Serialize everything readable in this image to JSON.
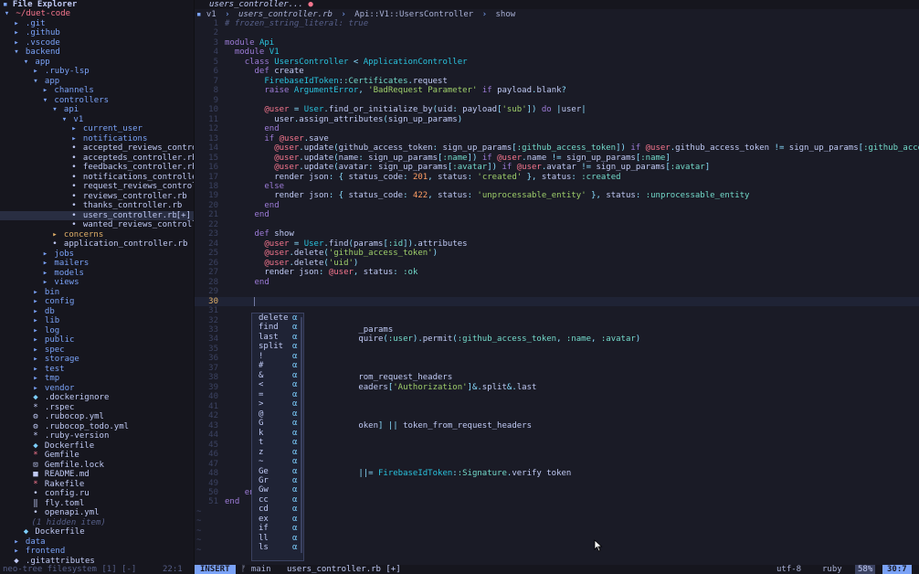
{
  "sidebar": {
    "title": "File Explorer",
    "hidden_note": "(1 hidden item)",
    "rows": [
      {
        "indent": 0,
        "icon": "▾",
        "label": "~/duet-code",
        "kind": "root"
      },
      {
        "indent": 1,
        "icon": "▸",
        "label": ".git",
        "kind": "dir"
      },
      {
        "indent": 1,
        "icon": "▸",
        "label": ".github",
        "kind": "dir"
      },
      {
        "indent": 1,
        "icon": "▸",
        "label": ".vscode",
        "kind": "dir"
      },
      {
        "indent": 1,
        "icon": "▾",
        "label": "backend",
        "kind": "dir"
      },
      {
        "indent": 2,
        "icon": "▾",
        "label": "app",
        "kind": "dir"
      },
      {
        "indent": 3,
        "icon": "▸",
        "label": ".ruby-lsp",
        "kind": "dir"
      },
      {
        "indent": 3,
        "icon": "▾",
        "label": "app",
        "kind": "dir"
      },
      {
        "indent": 4,
        "icon": "▸",
        "label": "channels",
        "kind": "dir"
      },
      {
        "indent": 4,
        "icon": "▾",
        "label": "controllers",
        "kind": "dir"
      },
      {
        "indent": 5,
        "icon": "▾",
        "label": "api",
        "kind": "dir"
      },
      {
        "indent": 6,
        "icon": "▾",
        "label": "v1",
        "kind": "dir"
      },
      {
        "indent": 7,
        "icon": "▸",
        "label": "current_user",
        "kind": "dir"
      },
      {
        "indent": 7,
        "icon": "▸",
        "label": "notifications",
        "kind": "dir"
      },
      {
        "indent": 7,
        "icon": "•",
        "label": "accepted_reviews_contro",
        "kind": "file"
      },
      {
        "indent": 7,
        "icon": "•",
        "label": "accepteds_controller.rb",
        "kind": "file"
      },
      {
        "indent": 7,
        "icon": "•",
        "label": "feedbacks_controller.rb",
        "kind": "file"
      },
      {
        "indent": 7,
        "icon": "•",
        "label": "notifications_controlle",
        "kind": "file"
      },
      {
        "indent": 7,
        "icon": "•",
        "label": "request_reviews_control",
        "kind": "file"
      },
      {
        "indent": 7,
        "icon": "•",
        "label": "reviews_controller.rb",
        "kind": "file"
      },
      {
        "indent": 7,
        "icon": "•",
        "label": "thanks_controller.rb",
        "kind": "file"
      },
      {
        "indent": 7,
        "icon": "•",
        "label": "users_controller.rb",
        "kind": "file",
        "selected": true,
        "suffix": "[+]"
      },
      {
        "indent": 7,
        "icon": "•",
        "label": "wanted_reviews_controll",
        "kind": "file"
      },
      {
        "indent": 5,
        "icon": "▸",
        "label": "concerns",
        "kind": "dir-mod"
      },
      {
        "indent": 5,
        "icon": "•",
        "label": "application_controller.rb",
        "kind": "file"
      },
      {
        "indent": 4,
        "icon": "▸",
        "label": "jobs",
        "kind": "dir"
      },
      {
        "indent": 4,
        "icon": "▸",
        "label": "mailers",
        "kind": "dir"
      },
      {
        "indent": 4,
        "icon": "▸",
        "label": "models",
        "kind": "dir"
      },
      {
        "indent": 4,
        "icon": "▸",
        "label": "views",
        "kind": "dir"
      },
      {
        "indent": 3,
        "icon": "▸",
        "label": "bin",
        "kind": "dir"
      },
      {
        "indent": 3,
        "icon": "▸",
        "label": "config",
        "kind": "dir"
      },
      {
        "indent": 3,
        "icon": "▸",
        "label": "db",
        "kind": "dir"
      },
      {
        "indent": 3,
        "icon": "▸",
        "label": "lib",
        "kind": "dir"
      },
      {
        "indent": 3,
        "icon": "▸",
        "label": "log",
        "kind": "dir"
      },
      {
        "indent": 3,
        "icon": "▸",
        "label": "public",
        "kind": "dir"
      },
      {
        "indent": 3,
        "icon": "▸",
        "label": "spec",
        "kind": "dir"
      },
      {
        "indent": 3,
        "icon": "▸",
        "label": "storage",
        "kind": "dir"
      },
      {
        "indent": 3,
        "icon": "▸",
        "label": "test",
        "kind": "dir"
      },
      {
        "indent": 3,
        "icon": "▸",
        "label": "tmp",
        "kind": "dir"
      },
      {
        "indent": 3,
        "icon": "▸",
        "label": "vendor",
        "kind": "dir"
      },
      {
        "indent": 3,
        "icon": "◆",
        "label": ".dockerignore",
        "kind": "file-blue"
      },
      {
        "indent": 3,
        "icon": "*",
        "label": ".rspec",
        "kind": "file"
      },
      {
        "indent": 3,
        "icon": "⚙",
        "label": ".rubocop.yml",
        "kind": "file"
      },
      {
        "indent": 3,
        "icon": "⚙",
        "label": ".rubocop_todo.yml",
        "kind": "file"
      },
      {
        "indent": 3,
        "icon": "*",
        "label": ".ruby-version",
        "kind": "file"
      },
      {
        "indent": 3,
        "icon": "◆",
        "label": "Dockerfile",
        "kind": "file-blue"
      },
      {
        "indent": 3,
        "icon": "*",
        "label": "Gemfile",
        "kind": "file-red"
      },
      {
        "indent": 3,
        "icon": "⊡",
        "label": "Gemfile.lock",
        "kind": "file"
      },
      {
        "indent": 3,
        "icon": "■",
        "label": "README.md",
        "kind": "file"
      },
      {
        "indent": 3,
        "icon": "*",
        "label": "Rakefile",
        "kind": "file-red"
      },
      {
        "indent": 3,
        "icon": "•",
        "label": "config.ru",
        "kind": "file"
      },
      {
        "indent": 3,
        "icon": "‖",
        "label": "fly.toml",
        "kind": "file"
      },
      {
        "indent": 3,
        "icon": "•",
        "label": "openapi.yml",
        "kind": "file"
      },
      {
        "indent": 3,
        "icon": "",
        "label": "(1 hidden item)",
        "kind": "muted"
      },
      {
        "indent": 2,
        "icon": "◆",
        "label": "Dockerfile",
        "kind": "file-blue"
      },
      {
        "indent": 1,
        "icon": "▸",
        "label": "data",
        "kind": "dir"
      },
      {
        "indent": 1,
        "icon": "▸",
        "label": "frontend",
        "kind": "dir"
      },
      {
        "indent": 1,
        "icon": "◆",
        "label": ".gitattributes",
        "kind": "file"
      }
    ]
  },
  "tabline": {
    "filename": "users_controller...",
    "modified_dot": "●"
  },
  "winbar": {
    "segments": [
      "v1",
      "users_controller.rb",
      "Api::V1::UsersController",
      "show"
    ],
    "sep": "›"
  },
  "code": {
    "current_line": 30,
    "lines": [
      {
        "n": 1,
        "t": "# frozen_string_literal: true"
      },
      {
        "n": 2,
        "t": ""
      },
      {
        "n": 3,
        "t": "module Api"
      },
      {
        "n": 4,
        "t": "  module V1"
      },
      {
        "n": 5,
        "t": "    class UsersController < ApplicationController"
      },
      {
        "n": 6,
        "t": "      def create"
      },
      {
        "n": 7,
        "t": "        FirebaseIdToken::Certificates.request"
      },
      {
        "n": 8,
        "t": "        raise ArgumentError, 'BadRequest Parameter' if payload.blank?"
      },
      {
        "n": 9,
        "t": ""
      },
      {
        "n": 10,
        "t": "        @user = User.find_or_initialize_by(uid: payload['sub']) do |user|"
      },
      {
        "n": 11,
        "t": "          user.assign_attributes(sign_up_params)"
      },
      {
        "n": 12,
        "t": "        end"
      },
      {
        "n": 13,
        "t": "        if @user.save"
      },
      {
        "n": 14,
        "t": "          @user.update(github_access_token: sign_up_params[:github_access_token]) if @user.github_access_token != sign_up_params[:github_access_to"
      },
      {
        "n": 15,
        "t": "          @user.update(name: sign_up_params[:name]) if @user.name != sign_up_params[:name]"
      },
      {
        "n": 16,
        "t": "          @user.update(avatar: sign_up_params[:avatar]) if @user.avatar != sign_up_params[:avatar]"
      },
      {
        "n": 17,
        "t": "          render json: { status_code: 201, status: 'created' }, status: :created"
      },
      {
        "n": 18,
        "t": "        else"
      },
      {
        "n": 19,
        "t": "          render json: { status_code: 422, status: 'unprocessable_entity' }, status: :unprocessable_entity"
      },
      {
        "n": 20,
        "t": "        end"
      },
      {
        "n": 21,
        "t": "      end"
      },
      {
        "n": 22,
        "t": ""
      },
      {
        "n": 23,
        "t": "      def show"
      },
      {
        "n": 24,
        "t": "        @user = User.find(params[:id]).attributes"
      },
      {
        "n": 25,
        "t": "        @user.delete('github_access_token')"
      },
      {
        "n": 26,
        "t": "        @user.delete('uid')"
      },
      {
        "n": 27,
        "t": "        render json: @user, status: :ok"
      },
      {
        "n": 28,
        "t": "      end"
      },
      {
        "n": 29,
        "t": ""
      },
      {
        "n": 30,
        "t": "      "
      },
      {
        "n": 31,
        "t": ""
      },
      {
        "n": 32,
        "t": ""
      },
      {
        "n": 33,
        "t": "                           _params"
      },
      {
        "n": 34,
        "t": "                           quire(:user).permit(:github_access_token, :name, :avatar)"
      },
      {
        "n": 35,
        "t": ""
      },
      {
        "n": 36,
        "t": ""
      },
      {
        "n": 37,
        "t": ""
      },
      {
        "n": 38,
        "t": "                           rom_request_headers"
      },
      {
        "n": 39,
        "t": "                           eaders['Authorization']&.split&.last"
      },
      {
        "n": 40,
        "t": ""
      },
      {
        "n": 41,
        "t": ""
      },
      {
        "n": 42,
        "t": ""
      },
      {
        "n": 43,
        "t": "                           oken] || token_from_request_headers"
      },
      {
        "n": 44,
        "t": ""
      },
      {
        "n": 45,
        "t": ""
      },
      {
        "n": 46,
        "t": ""
      },
      {
        "n": 47,
        "t": ""
      },
      {
        "n": 48,
        "t": "                           ||= FirebaseIdToken::Signature.verify token"
      },
      {
        "n": 49,
        "t": "      e"
      },
      {
        "n": 50,
        "t": "    end"
      },
      {
        "n": 51,
        "t": "end"
      }
    ]
  },
  "completion": {
    "kind_glyph": "α",
    "items": [
      "delete",
      "find",
      "last",
      "split",
      "!",
      "#",
      "&",
      "<",
      "=",
      ">",
      "@",
      "G",
      "k",
      "t",
      "z",
      "~",
      "Ge",
      "Gr",
      "Gw",
      "cc",
      "cd",
      "ex",
      "if",
      "ll",
      "ls"
    ]
  },
  "statusline": {
    "left": "neo-tree filesystem [1] [-]",
    "left_pos": "22:1",
    "mode": "INSERT",
    "branch": "ᚠ main",
    "file": "users_controller.rb [+]",
    "encoding": "utf-8",
    "filetype": "ruby",
    "percent": "58%",
    "cursor": "30:7"
  }
}
